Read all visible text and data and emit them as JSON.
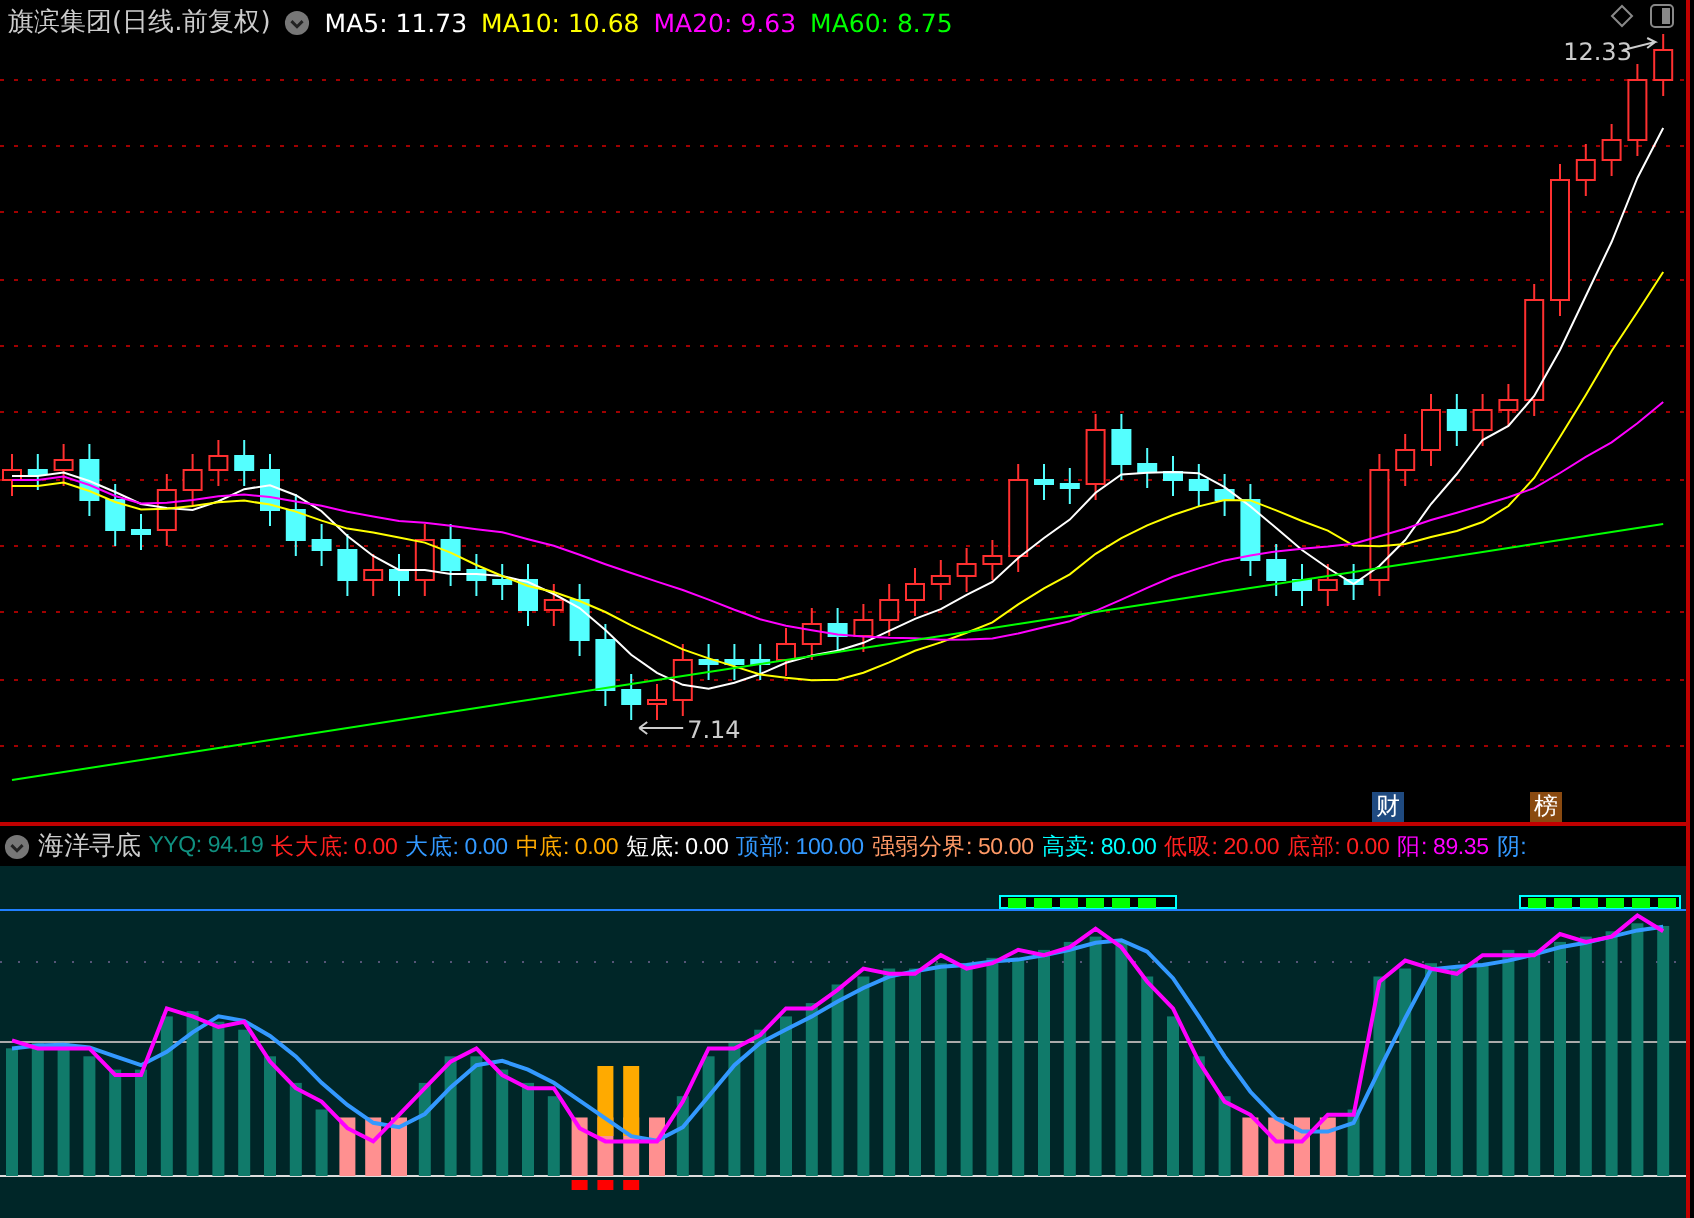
{
  "header": {
    "title": "旗滨集团(日线.前复权)",
    "ma": [
      {
        "label": "MA5: 11.73",
        "color": "#ffffff"
      },
      {
        "label": "MA10: 10.68",
        "color": "#ffff00"
      },
      {
        "label": "MA20: 9.63",
        "color": "#ff00ff"
      },
      {
        "label": "MA60: 8.75",
        "color": "#00ff00"
      }
    ]
  },
  "price_labels": {
    "high": "12.33",
    "low": "7.14"
  },
  "badges": [
    {
      "label": "财",
      "color": "#1f4a80"
    },
    {
      "label": "榜",
      "color": "#8a4a10"
    }
  ],
  "indicator": {
    "title": "海洋寻底",
    "legend": [
      {
        "label": "YYQ: 94.19",
        "color": "#109080"
      },
      {
        "label": "长大底: 0.00",
        "color": "#ff2020"
      },
      {
        "label": "大底: 0.00",
        "color": "#3399ff"
      },
      {
        "label": "中底: 0.00",
        "color": "#ffaa00"
      },
      {
        "label": "短底: 0.00",
        "color": "#ffffff"
      },
      {
        "label": "顶部: 100.00",
        "color": "#3399ff"
      },
      {
        "label": "强弱分界: 50.00",
        "color": "#ff9966"
      },
      {
        "label": "高卖: 80.00",
        "color": "#00ffff"
      },
      {
        "label": "低吸: 20.00",
        "color": "#ff2020"
      },
      {
        "label": "底部: 0.00",
        "color": "#ff2020"
      },
      {
        "label": "阳: 89.35",
        "color": "#ff00ff"
      },
      {
        "label": "阴:",
        "color": "#3399ff"
      }
    ]
  }
}
